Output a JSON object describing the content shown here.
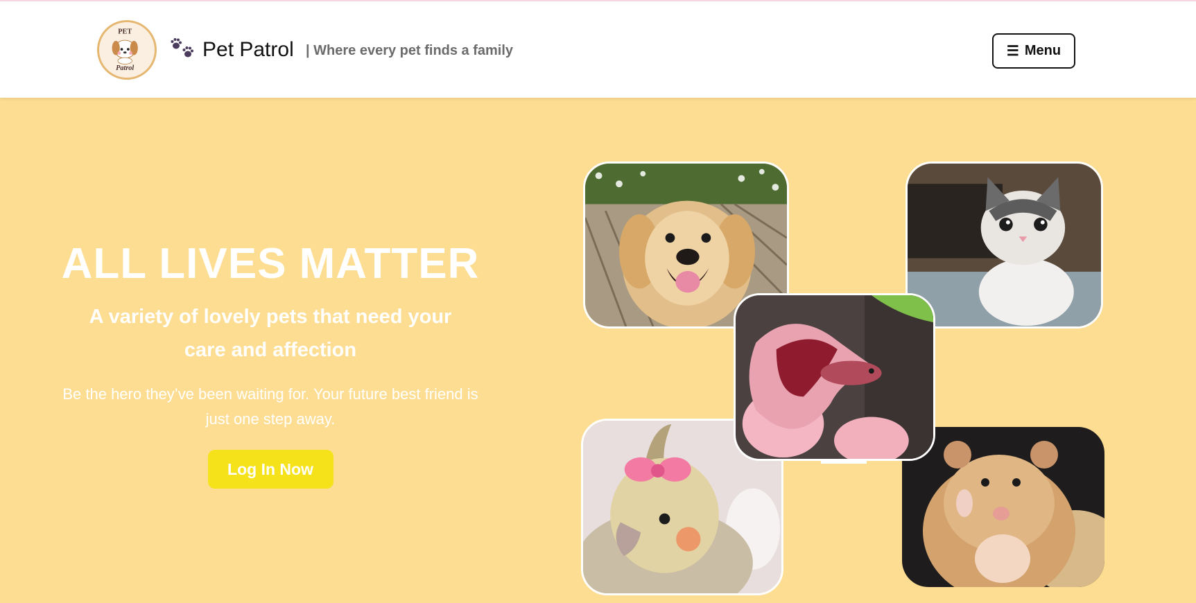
{
  "header": {
    "logo_text": "PET Patrol",
    "brand_icon": "paw-prints-icon",
    "brand_name": "Pet Patrol",
    "tagline": "| Where every pet finds a family",
    "menu_icon": "☰",
    "menu_label": "Menu"
  },
  "hero": {
    "title": "ALL LIVES MATTER",
    "subtitle": "A variety of lovely pets that need your care and affection",
    "description": "Be the hero they’ve been waiting for. Your future best friend is just one step away.",
    "cta_label": "Log In Now"
  },
  "gallery": [
    {
      "subject": "golden retriever puppy"
    },
    {
      "subject": "tabby kitten"
    },
    {
      "subject": "pink betta fish"
    },
    {
      "subject": "cockatiel with pink bow"
    },
    {
      "subject": "hamster waving"
    }
  ],
  "colors": {
    "hero_background": "#fddd92",
    "cta": "#f5e21a",
    "header_background": "#ffffff",
    "text_light": "#ffffff"
  }
}
